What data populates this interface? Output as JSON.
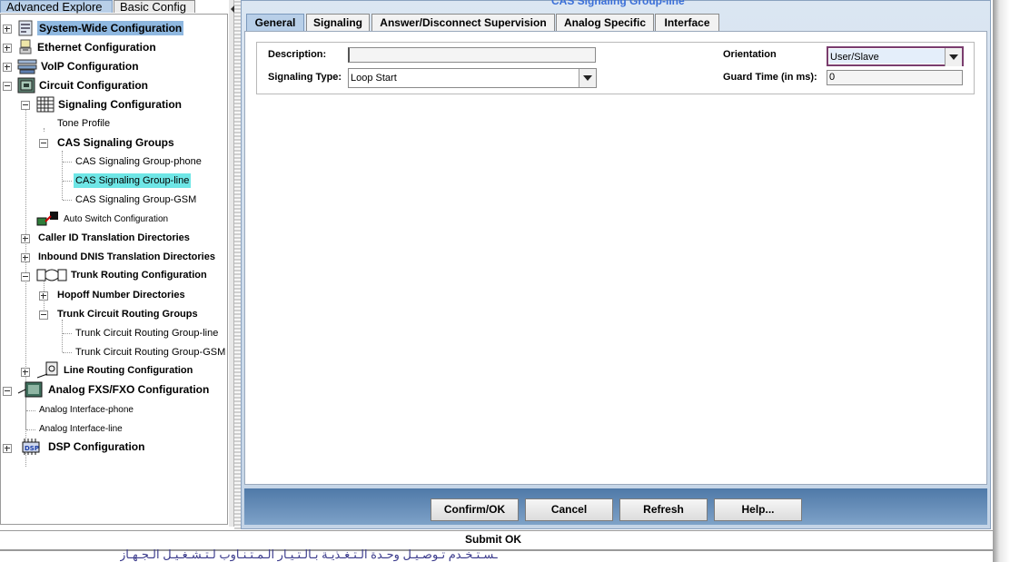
{
  "left_tabs": {
    "active": "Advanced Explore",
    "inactive": "Basic Config"
  },
  "tree": {
    "system_wide": "System-Wide Configuration",
    "ethernet": "Ethernet Configuration",
    "voip": "VoIP Configuration",
    "circuit": "Circuit Configuration",
    "signaling": "Signaling Configuration",
    "tone_profile": "Tone Profile",
    "cas_groups": "CAS Signaling Groups",
    "cas_phone": "CAS Signaling Group-phone",
    "cas_line": "CAS Signaling Group-line",
    "cas_gsm": "CAS Signaling Group-GSM",
    "auto_switch": "Auto Switch Configuration",
    "caller_id": "Caller ID Translation Directories",
    "inbound_dnis": "Inbound DNIS Translation Directories",
    "trunk_routing": "Trunk Routing Configuration",
    "hopoff": "Hopoff Number Directories",
    "trunk_groups": "Trunk Circuit Routing Groups",
    "trunk_line": "Trunk Circuit Routing Group-line",
    "trunk_gsm": "Trunk Circuit Routing Group-GSM",
    "line_routing": "Line Routing Configuration",
    "analog_fxs": "Analog FXS/FXO Configuration",
    "analog_phone": "Analog Interface-phone",
    "analog_line": "Analog Interface-line",
    "dsp": "DSP Configuration"
  },
  "panel": {
    "title": "CAS Signaling Group-line",
    "tabs": [
      "General",
      "Signaling",
      "Answer/Disconnect Supervision",
      "Analog Specific",
      "Interface"
    ],
    "active_tab": "General",
    "form": {
      "description_label": "Description:",
      "description_value": "",
      "signaling_type_label": "Signaling Type:",
      "signaling_type_value": "Loop Start",
      "orientation_label": "Orientation",
      "orientation_value": "User/Slave",
      "guard_time_label": "Guard Time (in ms):",
      "guard_time_value": "0"
    },
    "buttons": {
      "confirm": "Confirm/OK",
      "cancel": "Cancel",
      "refresh": "Refresh",
      "help": "Help..."
    }
  },
  "status": "Submit OK",
  "background_text": "ـسـتـخـدم تـوصـيـل وحـدة الـتـغـذيـة بـالـتـيـار الـمـتـنـاوب لـتـشـغـيـل الـجـهـاز"
}
